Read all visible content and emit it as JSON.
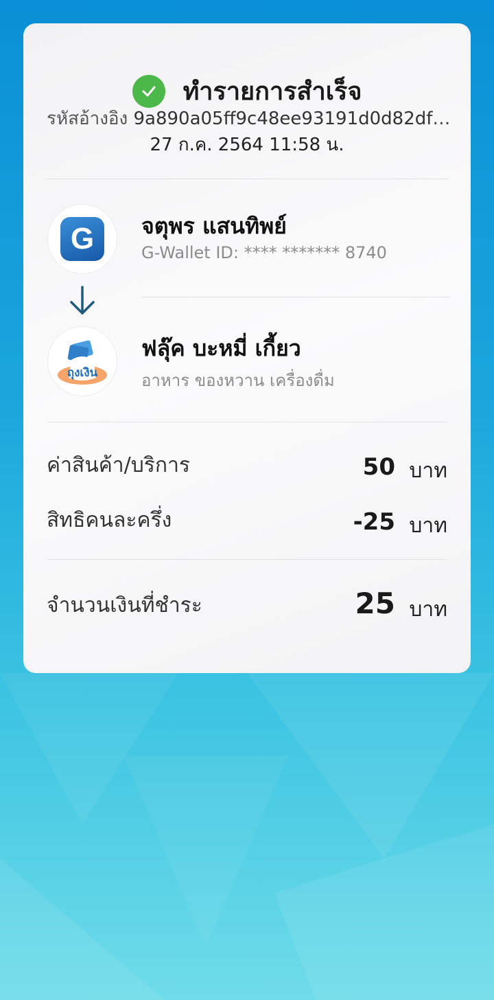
{
  "header": {
    "title": "ทำรายการสำเร็จ"
  },
  "reference": {
    "label": "รหัสอ้างอิง",
    "value": "9a890a05ff9c48ee93191d0d82dfbf..."
  },
  "datetime": "27 ก.ค. 2564 11:58 น.",
  "payer": {
    "logo_letter": "G",
    "name": "จตุพร แสนทิพย์",
    "sub": "G-Wallet ID: **** ******* 8740",
    "icon": "g-wallet-logo"
  },
  "payee": {
    "logo_text": "ถุงเงิน",
    "name": "ฟลุ๊ค บะหมี่ เกี้ยว",
    "sub": "อาหาร ของหวาน เครื่องดื่ม",
    "icon": "thung-ngoen-logo"
  },
  "summary": {
    "rows": [
      {
        "label": "ค่าสินค้า/บริการ",
        "amount": "50",
        "unit": "บาท"
      },
      {
        "label": "สิทธิคนละครึ่ง",
        "amount": "-25",
        "unit": "บาท"
      }
    ],
    "total": {
      "label": "จำนวนเงินที่ชำระ",
      "amount": "25",
      "unit": "บาท"
    }
  },
  "colors": {
    "success": "#4cb84a",
    "arrow": "#1f5b7d",
    "background_top": "#0a8fd6",
    "background_bottom": "#6fdce9"
  }
}
